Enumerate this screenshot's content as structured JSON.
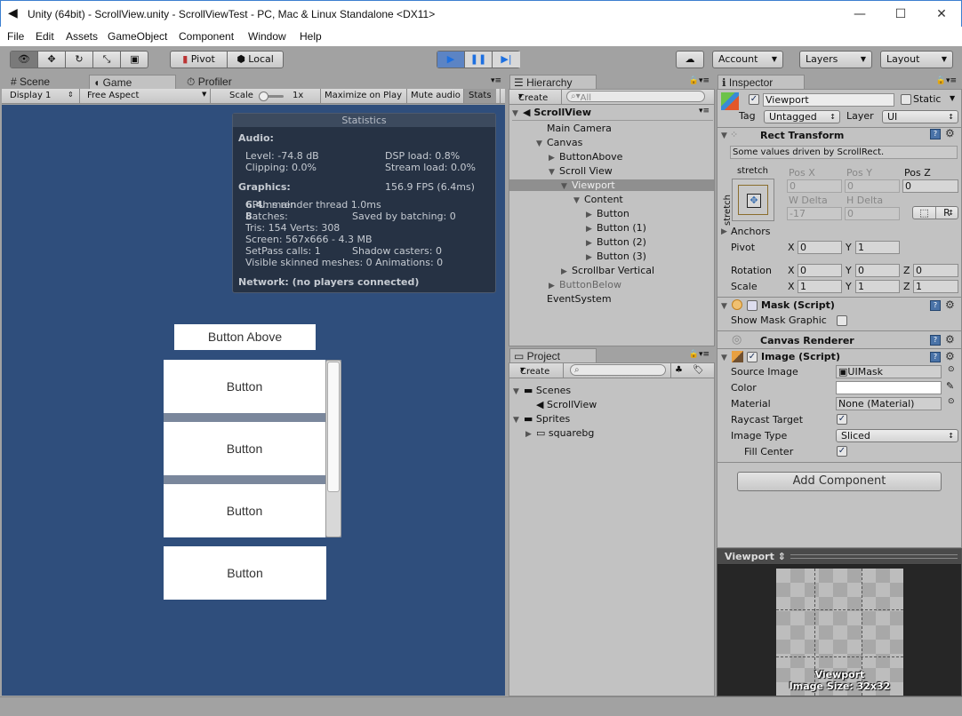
{
  "window": {
    "title": "Unity (64bit) - ScrollView.unity - ScrollViewTest - PC, Mac & Linux Standalone <DX11>",
    "minimize": "—",
    "maximize": "☐",
    "close": "✕"
  },
  "menu": [
    "File",
    "Edit",
    "Assets",
    "GameObject",
    "Component",
    "Window",
    "Help"
  ],
  "toolbar": {
    "tools": [
      "view-tool",
      "move-tool",
      "rotate-tool",
      "scale-tool",
      "rect-tool"
    ],
    "pivot": "Pivot",
    "local": "Local",
    "play": "▶",
    "pause": "❚❚",
    "step": "▶|",
    "account": "Account",
    "layers": "Layers",
    "layout": "Layout",
    "accent": "#3a7bd5"
  },
  "game_panel": {
    "tabs": [
      "Scene",
      "Game",
      "Profiler"
    ],
    "display": "Display 1",
    "aspect": "Free Aspect",
    "scale_label": "Scale",
    "scale_value": "1x",
    "maximize": "Maximize on Play",
    "mute": "Mute audio",
    "stats": "Stats",
    "bg_color": "#2f4e7c",
    "statistics": {
      "title": "Statistics",
      "audio": "Audio:",
      "level": "Level: -74.8 dB",
      "dsp": "DSP load: 0.8%",
      "clipping": "Clipping: 0.0%",
      "stream": "Stream load: 0.0%",
      "graphics": "Graphics:",
      "fps": "156.9 FPS (6.4ms)",
      "cpu_a": "CPU: main ",
      "cpu_b": "6.4",
      "cpu_c": "ms  render thread 1.0ms",
      "batches_a": "Batches: ",
      "batches_b": "8",
      "saved": "Saved by batching: 0",
      "tris": "Tris: 154  Verts: 308",
      "screen": "Screen: 567x666 - 4.3 MB",
      "setpass": "SetPass calls: 1",
      "shadow": "Shadow casters: 0",
      "skinned": "Visible skinned meshes: 0  Animations: 0",
      "network": "Network: (no players connected)"
    },
    "button_above": "Button Above",
    "buttons": [
      "Button",
      "Button",
      "Button",
      "Button"
    ],
    "scrollbar_handle_fraction": 0.75
  },
  "hierarchy": {
    "tab": "Hierarchy",
    "create": "Create",
    "search_placeholder": "All",
    "scene": "ScrollView",
    "items": [
      {
        "label": "Main Camera",
        "depth": 0,
        "arrow": ""
      },
      {
        "label": "Canvas",
        "depth": 0,
        "arrow": "▼"
      },
      {
        "label": "ButtonAbove",
        "depth": 1,
        "arrow": "▶"
      },
      {
        "label": "Scroll View",
        "depth": 1,
        "arrow": "▼"
      },
      {
        "label": "Viewport",
        "depth": 2,
        "arrow": "▼",
        "selected": true
      },
      {
        "label": "Content",
        "depth": 3,
        "arrow": "▼"
      },
      {
        "label": "Button",
        "depth": 4,
        "arrow": "▶"
      },
      {
        "label": "Button (1)",
        "depth": 4,
        "arrow": "▶"
      },
      {
        "label": "Button (2)",
        "depth": 4,
        "arrow": "▶"
      },
      {
        "label": "Button (3)",
        "depth": 4,
        "arrow": "▶"
      },
      {
        "label": "Scrollbar Vertical",
        "depth": 2,
        "arrow": "▶"
      },
      {
        "label": "ButtonBelow",
        "depth": 1,
        "arrow": "▶",
        "disabled": true
      },
      {
        "label": "EventSystem",
        "depth": 0,
        "arrow": ""
      }
    ]
  },
  "project": {
    "tab": "Project",
    "create": "Create",
    "items": [
      {
        "label": "Scenes",
        "depth": 0,
        "arrow": "▼",
        "icon": "folder"
      },
      {
        "label": "ScrollView",
        "depth": 1,
        "arrow": "",
        "icon": "unity"
      },
      {
        "label": "Sprites",
        "depth": 0,
        "arrow": "▼",
        "icon": "folder"
      },
      {
        "label": "squarebg",
        "depth": 1,
        "arrow": "▶",
        "icon": "sprite"
      }
    ]
  },
  "inspector": {
    "tab": "Inspector",
    "name": "Viewport",
    "static": "Static",
    "tag_label": "Tag",
    "tag": "Untagged",
    "layer_label": "Layer",
    "layer": "UI",
    "rect": {
      "title": "Rect Transform",
      "note": "Some values driven by ScrollRect.",
      "anchor_h": "stretch",
      "anchor_v": "stretch",
      "posx_l": "Pos X",
      "posy_l": "Pos Y",
      "posz_l": "Pos Z",
      "posx": "0",
      "posy": "0",
      "posz": "0",
      "wd_l": "W Delta",
      "hd_l": "H Delta",
      "wd": "-17",
      "hd": "0",
      "r": "R",
      "anchors": "Anchors",
      "pivot": "Pivot",
      "pivot_x": "0",
      "pivot_y": "1",
      "rotation": "Rotation",
      "rot_x": "0",
      "rot_y": "0",
      "rot_z": "0",
      "scale": "Scale",
      "sc_x": "1",
      "sc_y": "1",
      "sc_z": "1",
      "x": "X",
      "y": "Y",
      "z": "Z"
    },
    "mask": {
      "title": "Mask (Script)",
      "show": "Show Mask Graphic"
    },
    "canvas_renderer": "Canvas Renderer",
    "image": {
      "title": "Image (Script)",
      "source_l": "Source Image",
      "source": "UIMask",
      "color_l": "Color",
      "material_l": "Material",
      "material": "None (Material)",
      "raycast_l": "Raycast Target",
      "type_l": "Image Type",
      "type": "Sliced",
      "fill_l": "Fill Center",
      "color": "#ffffff"
    },
    "add": "Add Component",
    "preview": {
      "title": "Viewport",
      "caption1": "Viewport",
      "caption2": "Image Size: 32x32"
    }
  }
}
